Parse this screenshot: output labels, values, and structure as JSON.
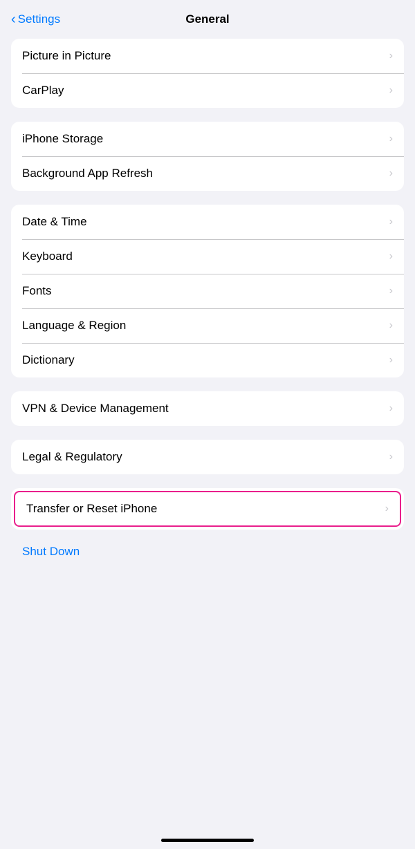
{
  "header": {
    "back_label": "Settings",
    "title": "General"
  },
  "sections": [
    {
      "id": "section1",
      "rows": [
        {
          "label": "Picture in Picture",
          "chevron": true
        },
        {
          "label": "CarPlay",
          "chevron": true
        }
      ]
    },
    {
      "id": "section2",
      "rows": [
        {
          "label": "iPhone Storage",
          "chevron": true
        },
        {
          "label": "Background App Refresh",
          "chevron": true
        }
      ]
    },
    {
      "id": "section3",
      "rows": [
        {
          "label": "Date & Time",
          "chevron": true
        },
        {
          "label": "Keyboard",
          "chevron": true
        },
        {
          "label": "Fonts",
          "chevron": true
        },
        {
          "label": "Language & Region",
          "chevron": true
        },
        {
          "label": "Dictionary",
          "chevron": true
        }
      ]
    },
    {
      "id": "section4",
      "rows": [
        {
          "label": "VPN & Device Management",
          "chevron": true
        }
      ]
    },
    {
      "id": "section5",
      "rows": [
        {
          "label": "Legal & Regulatory",
          "chevron": true
        }
      ]
    }
  ],
  "transfer_reset": {
    "label": "Transfer or Reset iPhone",
    "chevron": true
  },
  "shutdown": {
    "label": "Shut Down"
  },
  "chevron_char": "›"
}
